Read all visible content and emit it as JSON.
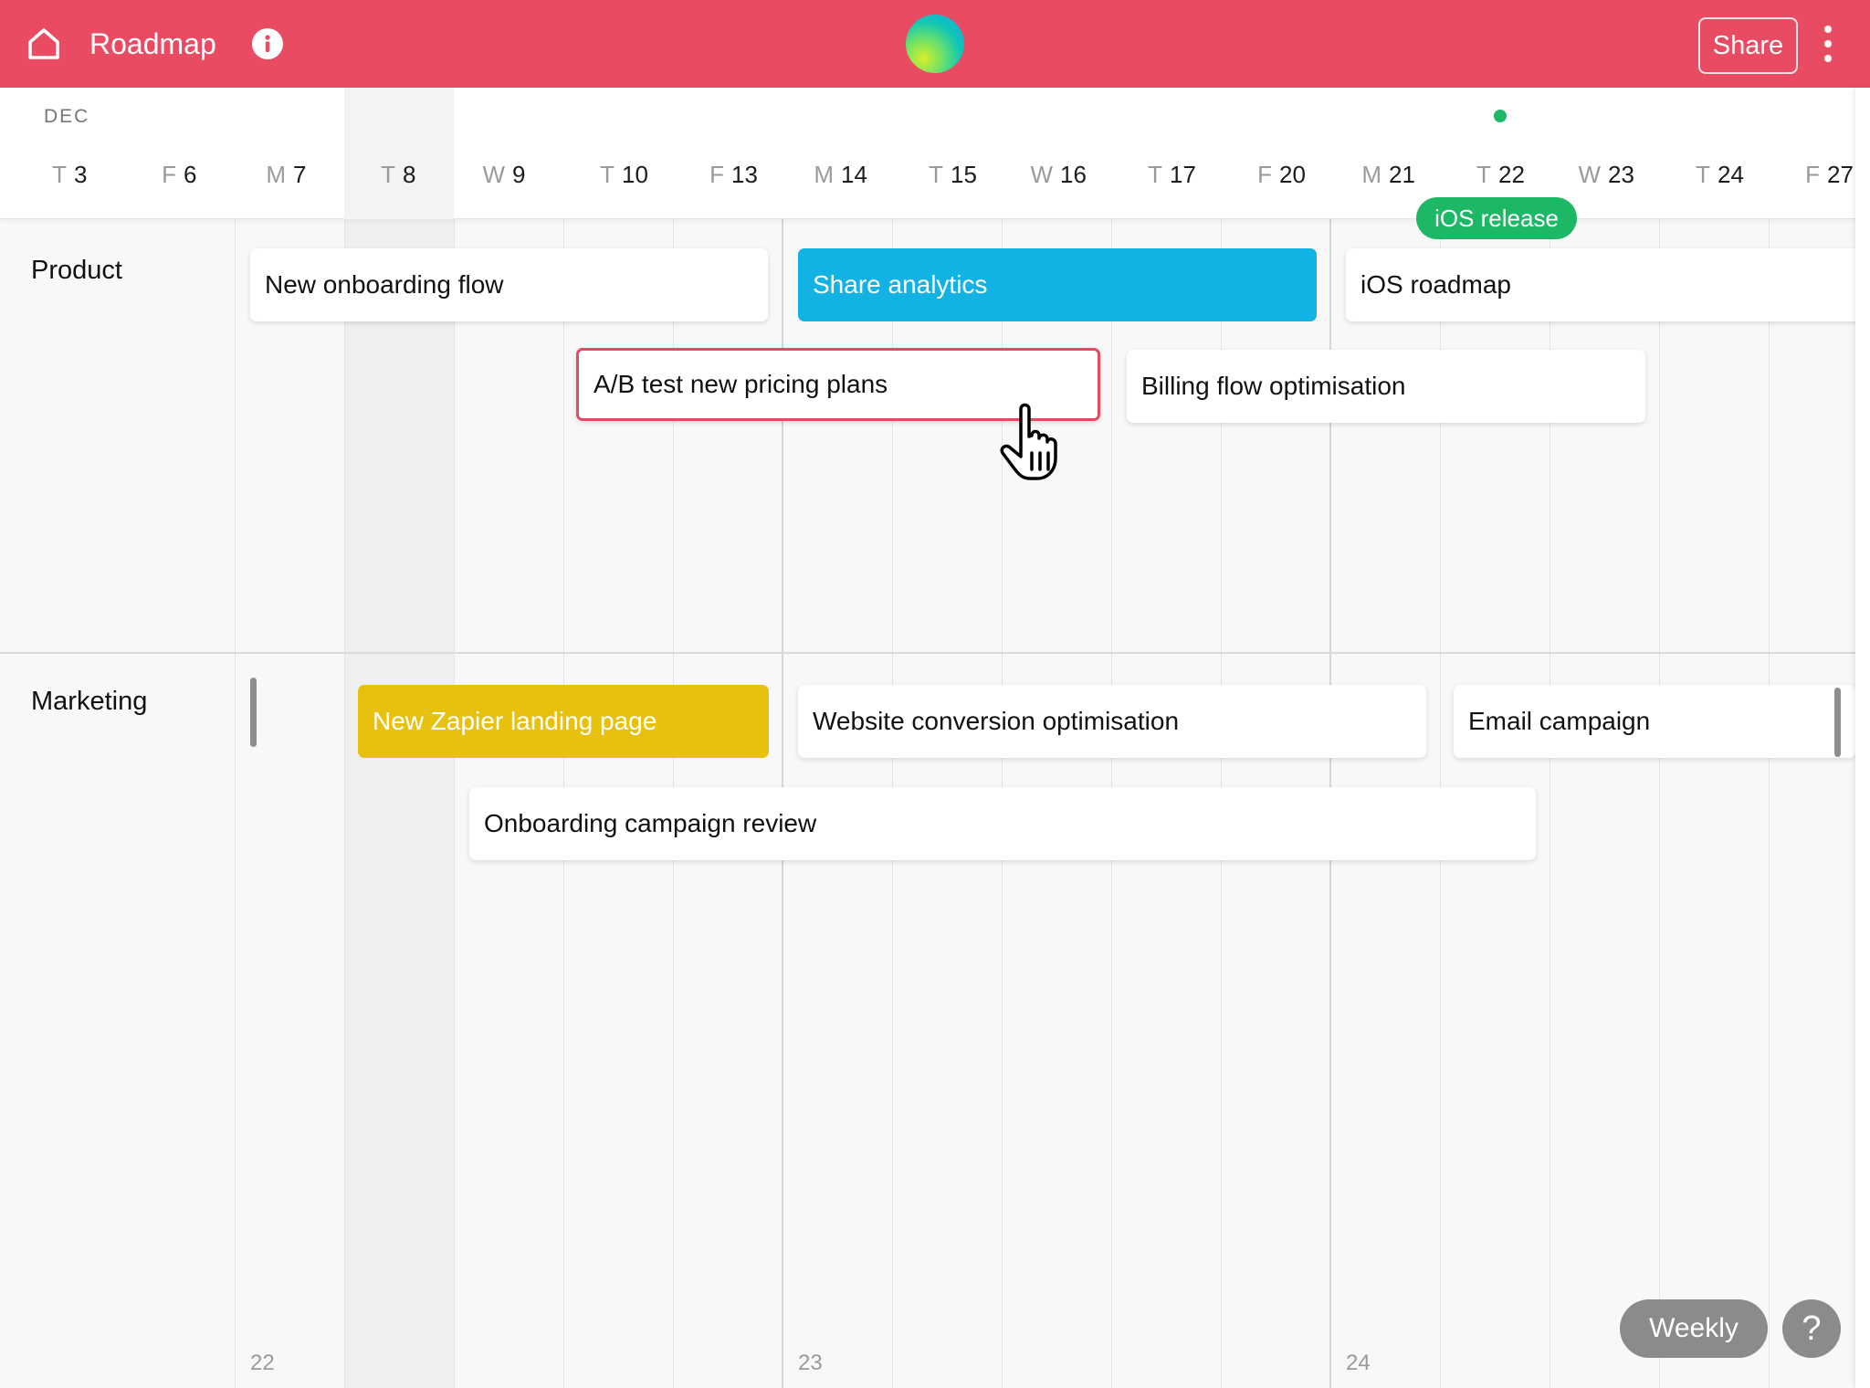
{
  "header": {
    "title": "Roadmap",
    "share_label": "Share",
    "icons": {
      "home": "home-icon",
      "info": "info-icon",
      "more": "more-vertical-icon"
    },
    "colors": {
      "brand": "#e94b63"
    }
  },
  "timeline": {
    "month": "DEC",
    "days": [
      {
        "wd": "T",
        "dn": "3"
      },
      {
        "wd": "F",
        "dn": "6"
      },
      {
        "wd": "M",
        "dn": "7"
      },
      {
        "wd": "T",
        "dn": "8"
      },
      {
        "wd": "W",
        "dn": "9"
      },
      {
        "wd": "T",
        "dn": "10"
      },
      {
        "wd": "F",
        "dn": "13"
      },
      {
        "wd": "M",
        "dn": "14"
      },
      {
        "wd": "T",
        "dn": "15"
      },
      {
        "wd": "W",
        "dn": "16"
      },
      {
        "wd": "T",
        "dn": "17"
      },
      {
        "wd": "F",
        "dn": "20"
      },
      {
        "wd": "M",
        "dn": "21"
      },
      {
        "wd": "T",
        "dn": "22"
      },
      {
        "wd": "W",
        "dn": "23"
      },
      {
        "wd": "T",
        "dn": "24"
      },
      {
        "wd": "F",
        "dn": "27"
      }
    ],
    "week_numbers": [
      "22",
      "23",
      "24"
    ],
    "milestone": {
      "label": "iOS release",
      "color": "#1db866"
    }
  },
  "groups": {
    "product": {
      "label": "Product",
      "cards": {
        "new_onboarding_flow": "New onboarding flow",
        "share_analytics": "Share analytics",
        "ios_roadmap": "iOS roadmap",
        "ab_test": "A/B test new pricing plans",
        "billing_flow": "Billing flow optimisation"
      }
    },
    "marketing": {
      "label": "Marketing",
      "cards": {
        "zapier_landing": "New Zapier landing page",
        "website_conversion": "Website conversion optimisation",
        "email_campaign": "Email campaign",
        "onboarding_review": "Onboarding campaign review"
      }
    }
  },
  "card_colors": {
    "blue": "#13b2e5",
    "yellow": "#e8c10f",
    "selected_border": "#e24b62"
  },
  "footer": {
    "view_mode": "Weekly",
    "help_label": "?"
  }
}
